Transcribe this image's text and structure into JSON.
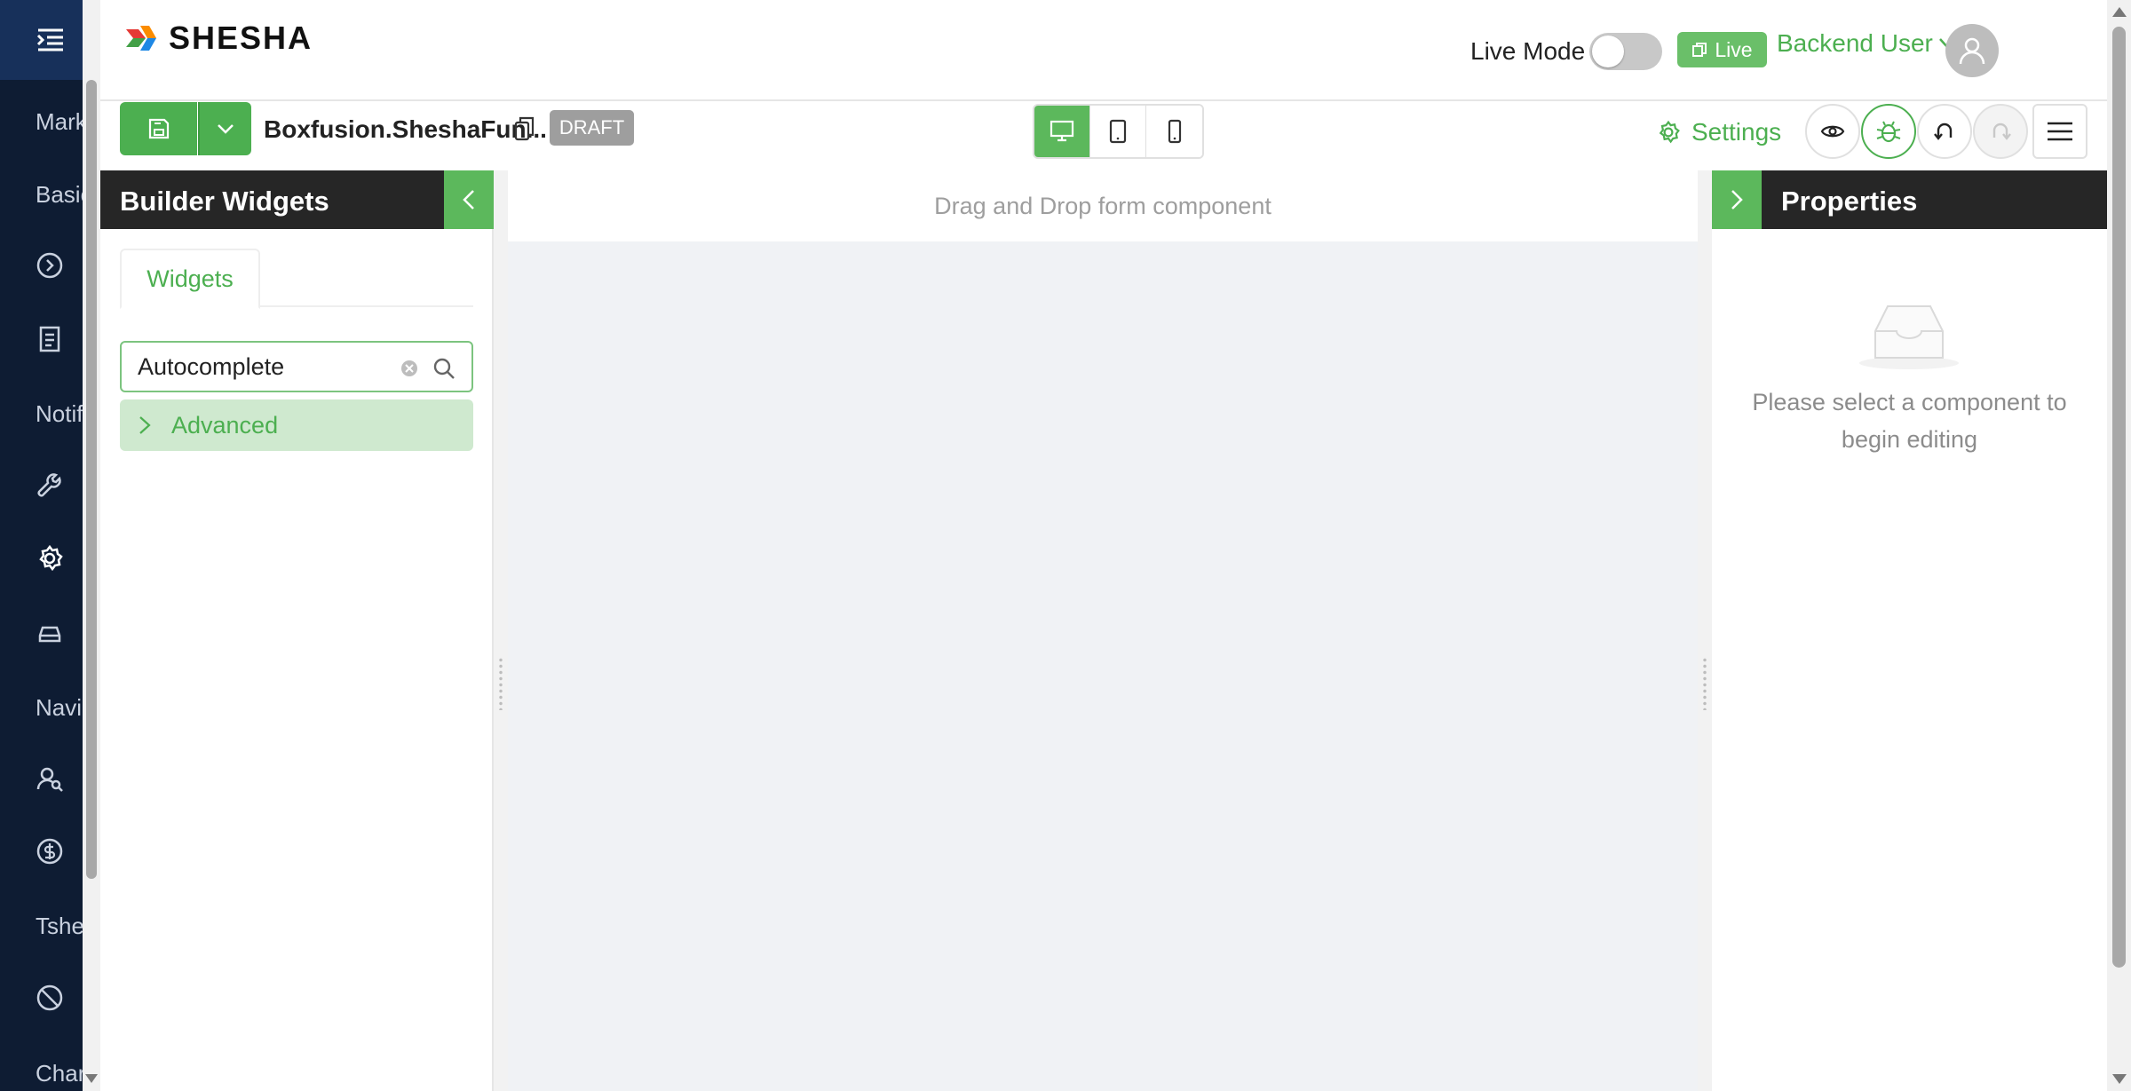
{
  "sidebar": {
    "items": [
      {
        "label": "Mark",
        "icon": "text"
      },
      {
        "label": "Basic",
        "icon": "text"
      },
      {
        "label": "",
        "icon": "play-circle-icon"
      },
      {
        "label": "",
        "icon": "document-icon"
      },
      {
        "label": "Notif",
        "icon": "text"
      },
      {
        "label": "",
        "icon": "wrench-icon"
      },
      {
        "label": "",
        "icon": "gear-icon"
      },
      {
        "label": "",
        "icon": "car-icon"
      },
      {
        "label": "Navi",
        "icon": "text"
      },
      {
        "label": "",
        "icon": "user-search-icon"
      },
      {
        "label": "",
        "icon": "dollar-circle-icon"
      },
      {
        "label": "Tshe",
        "icon": "text"
      },
      {
        "label": "",
        "icon": "blocked-icon"
      },
      {
        "label": "Char",
        "icon": "text"
      }
    ]
  },
  "header": {
    "brand": "SHESHA",
    "live_mode_label": "Live Mode",
    "live_mode_on": false,
    "live_badge": "Live",
    "user_name": "Backend User"
  },
  "toolbar": {
    "form_name": "Boxfusion.SheshaFun...",
    "status_badge": "DRAFT",
    "settings_label": "Settings",
    "active_device": "desktop"
  },
  "widgets_panel": {
    "title": "Builder Widgets",
    "tab_label": "Widgets",
    "search_value": "Autocomplete",
    "groups": [
      "Advanced"
    ]
  },
  "canvas": {
    "hint": "Drag and Drop form component"
  },
  "properties_panel": {
    "title": "Properties",
    "empty_line1": "Please select a component to",
    "empty_line2": "begin editing"
  },
  "colors": {
    "accent": "#4caf50",
    "sidebar_bg": "#0e1c33",
    "panel_header_bg": "#262626",
    "draft_badge": "#9e9e9e"
  }
}
